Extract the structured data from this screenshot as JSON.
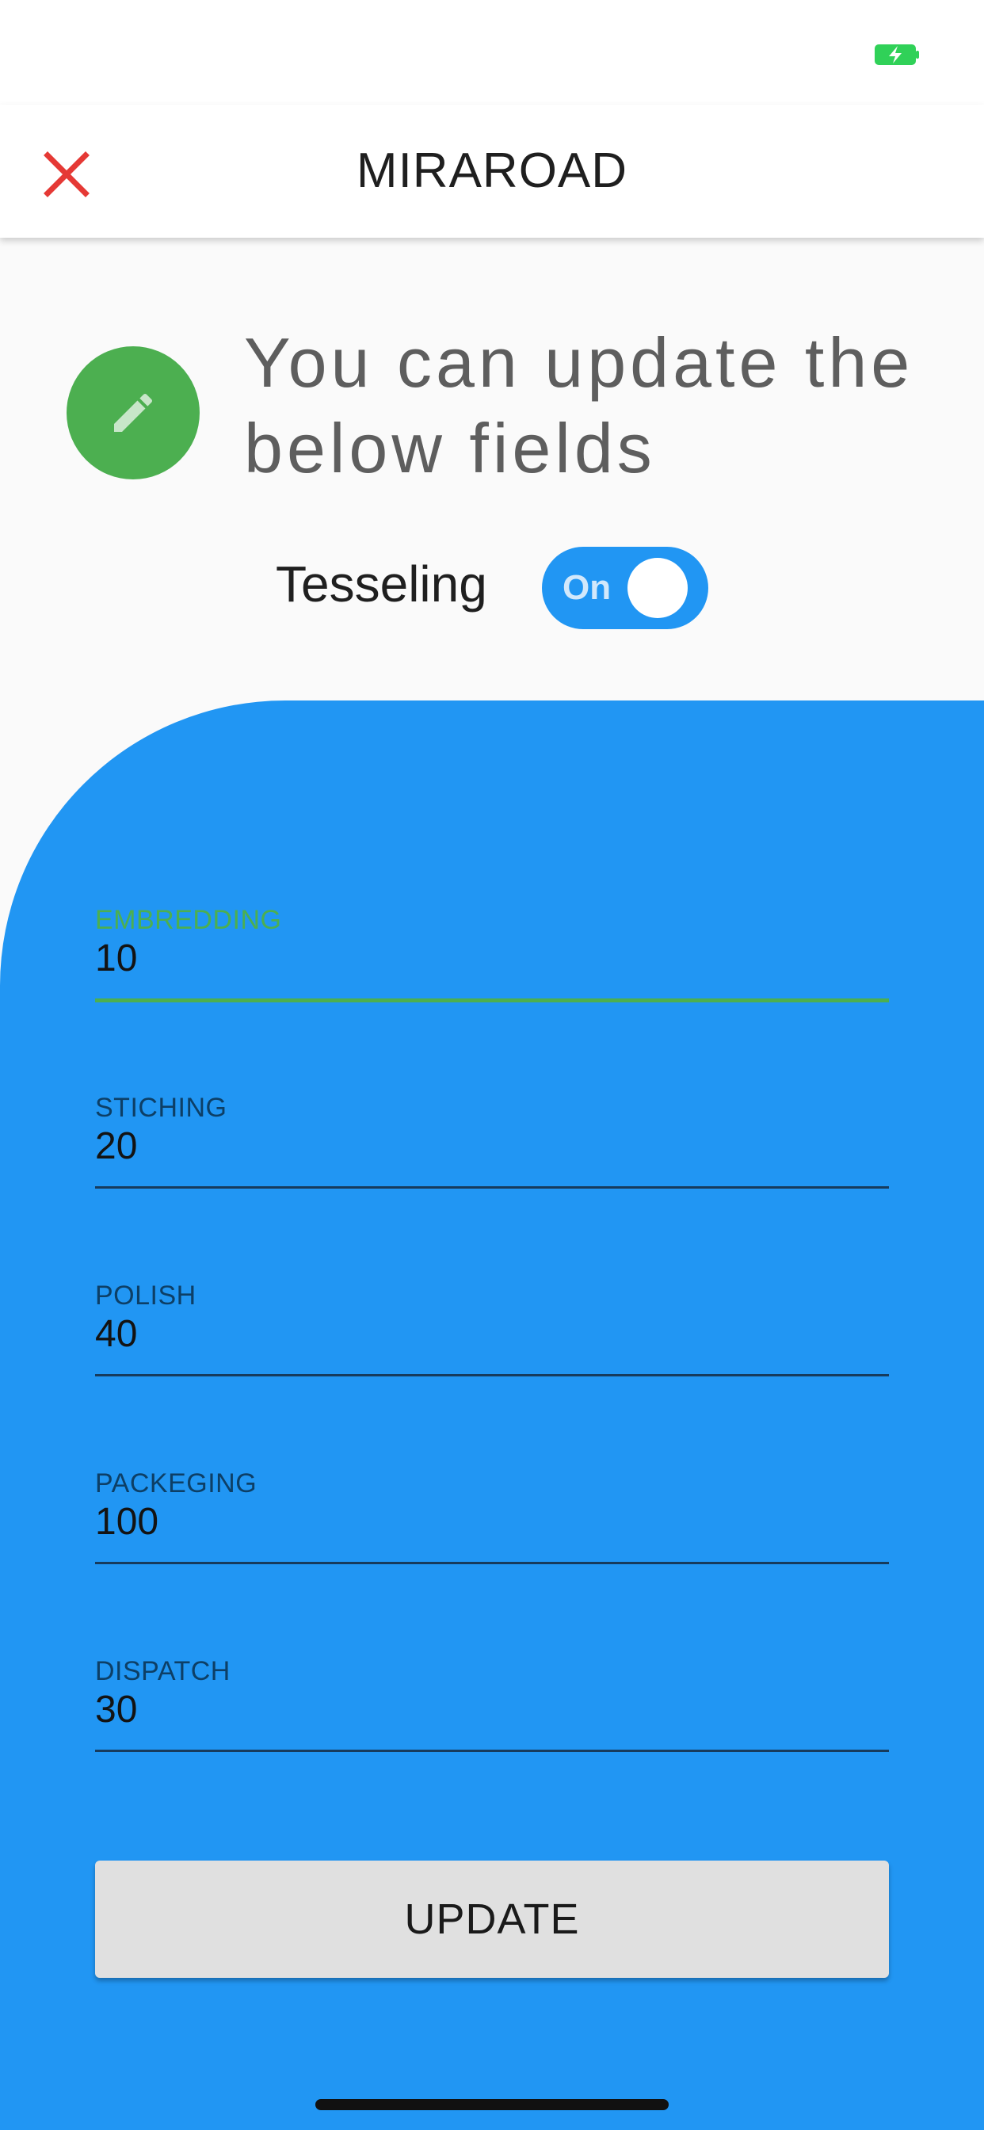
{
  "app_bar": {
    "title": "MIRAROAD",
    "close_icon": "close-icon",
    "close_color": "#e53935"
  },
  "status_bar": {
    "battery_icon": "battery-charging-icon",
    "battery_color": "#30d158"
  },
  "header": {
    "icon": "pencil-icon",
    "icon_bg": "#4caf50",
    "headline": "You can update the below fields"
  },
  "toggle": {
    "label": "Tesseling",
    "state_text": "On",
    "on": true,
    "color": "#2196f3"
  },
  "form": {
    "panel_color": "#2196f3",
    "fields": [
      {
        "label": "EMBREDDING",
        "value": "10",
        "focused": true
      },
      {
        "label": "STICHING",
        "value": "20",
        "focused": false
      },
      {
        "label": "POLISH",
        "value": "40",
        "focused": false
      },
      {
        "label": "PACKEGING",
        "value": "100",
        "focused": false
      },
      {
        "label": "DISPATCH",
        "value": "30",
        "focused": false
      }
    ],
    "focus_color": "#4caf50",
    "submit_label": "UPDATE"
  }
}
